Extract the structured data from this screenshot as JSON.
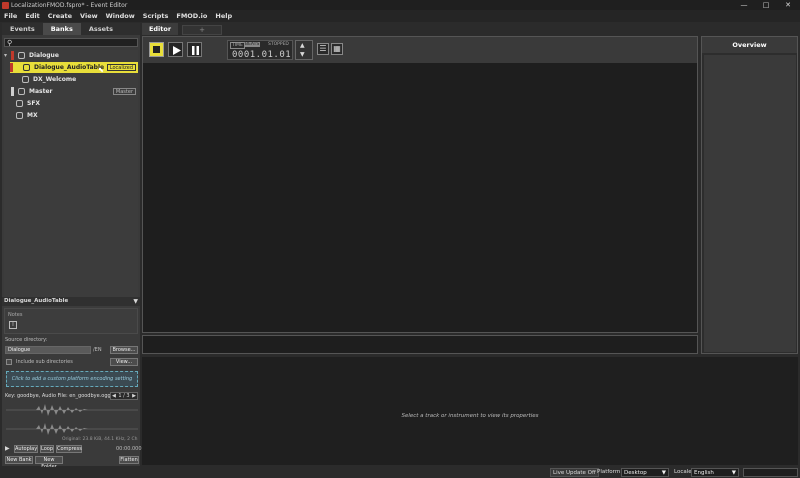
{
  "window": {
    "title": "LocalizationFMOD.fspro* - Event Editor",
    "controls": [
      "—",
      "□",
      "✕"
    ]
  },
  "menu": [
    "File",
    "Edit",
    "Create",
    "View",
    "Window",
    "Scripts",
    "FMOD.io",
    "Help"
  ],
  "left_tabs": [
    "Events",
    "Banks",
    "Assets"
  ],
  "left_active_tab": "Banks",
  "tree": {
    "items": [
      {
        "label": "Dialogue"
      },
      {
        "label": "Dialogue_AudioTable",
        "badge": "Localized"
      },
      {
        "label": "DX_Welcome"
      },
      {
        "label": "Master",
        "badge": "Master"
      },
      {
        "label": "SFX"
      },
      {
        "label": "MX"
      }
    ]
  },
  "properties": {
    "header": "Dialogue_AudioTable",
    "notes_label": "Notes",
    "source_dir_label": "Source directory:",
    "source_dir_value": "Dialogue",
    "source_dir_suffix": "/EN",
    "browse": "Browse...",
    "include_sub": "Include sub directories",
    "view": "View...",
    "platform_hint": "Click to add a custom platform encoding setting",
    "key_line": "Key: goodbye, Audio File: en_goodbye.ogg",
    "pager": "1 / 3",
    "original": "Original: 23.8 KiB, 44.1 KHz, 2 Ch",
    "autoplay": "Autoplay",
    "loop": "Loop",
    "compress": "Compress",
    "duration": "00:00.000",
    "new_bank": "New Bank",
    "new_folder": "New Folder",
    "flatten": "Flatten"
  },
  "editor": {
    "tab": "Editor",
    "add_tab": "+",
    "time_labels": [
      "TIME",
      "BEATS",
      "STOPPED"
    ],
    "time_value": "0001.01.01"
  },
  "overview_title": "Overview",
  "property_hint": "Select a track or instrument to view its properties",
  "status": {
    "live_update": "Live Update Off",
    "platform_label": "Platform",
    "platform_value": "Desktop",
    "locale_label": "Locale",
    "locale_value": "English"
  },
  "colors": {
    "accent": "#e8de3a",
    "bank_strip_red": "#c0392b",
    "bank_strip_master": "#cfcfcf"
  }
}
